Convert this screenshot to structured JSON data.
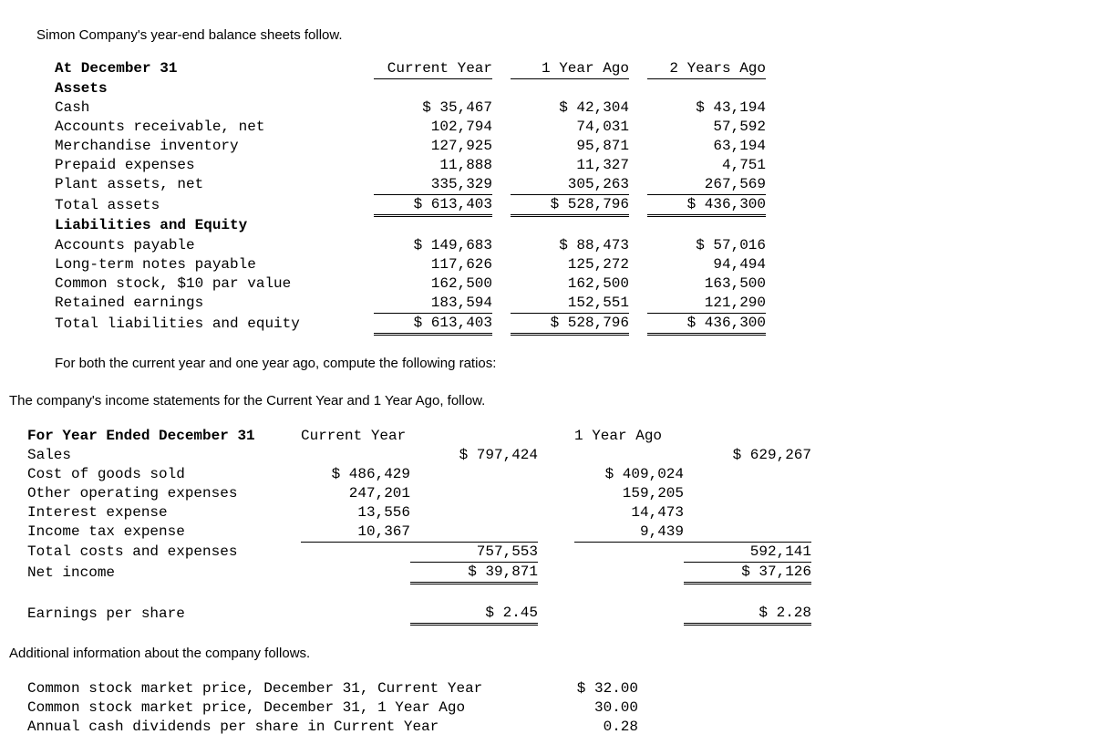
{
  "intro1": "Simon Company's year-end balance sheets follow.",
  "bs": {
    "header": {
      "label": "At December 31",
      "c1": "Current Year",
      "c2": "1 Year Ago",
      "c3": "2 Years Ago"
    },
    "assets_hdr": "Assets",
    "rows_assets": [
      {
        "label": "Cash",
        "c1": "$ 35,467",
        "c2": "$ 42,304",
        "c3": "$ 43,194"
      },
      {
        "label": "Accounts receivable, net",
        "c1": "102,794",
        "c2": "74,031",
        "c3": "57,592"
      },
      {
        "label": "Merchandise inventory",
        "c1": "127,925",
        "c2": "95,871",
        "c3": "63,194"
      },
      {
        "label": "Prepaid expenses",
        "c1": "11,888",
        "c2": "11,327",
        "c3": "4,751"
      },
      {
        "label": "Plant assets, net",
        "c1": "335,329",
        "c2": "305,263",
        "c3": "267,569"
      }
    ],
    "total_assets": {
      "label": "Total assets",
      "c1": "$ 613,403",
      "c2": "$ 528,796",
      "c3": "$ 436,300"
    },
    "liab_hdr": "Liabilities and Equity",
    "rows_liab": [
      {
        "label": "Accounts payable",
        "c1": "$ 149,683",
        "c2": "$ 88,473",
        "c3": "$ 57,016"
      },
      {
        "label": "Long-term notes payable",
        "c1": "117,626",
        "c2": "125,272",
        "c3": "94,494"
      },
      {
        "label": "Common stock, $10 par value",
        "c1": "162,500",
        "c2": "162,500",
        "c3": "163,500"
      },
      {
        "label": "Retained earnings",
        "c1": "183,594",
        "c2": "152,551",
        "c3": "121,290"
      }
    ],
    "total_liab": {
      "label": "Total liabilities and equity",
      "c1": "$ 613,403",
      "c2": "$ 528,796",
      "c3": "$ 436,300"
    }
  },
  "intro2": "For both the current year and one year ago, compute the following ratios:",
  "intro3": "The company's income statements for the Current Year and 1 Year Ago, follow.",
  "is": {
    "header": {
      "label": "For Year Ended December 31",
      "c1": "Current Year",
      "c2": "1 Year Ago"
    },
    "sales": {
      "label": "Sales",
      "c1": "$ 797,424",
      "c2": "$ 629,267"
    },
    "expenses": [
      {
        "label": "Cost of goods sold",
        "c1": "$ 486,429",
        "c2": "$ 409,024"
      },
      {
        "label": "Other operating expenses",
        "c1": "247,201",
        "c2": "159,205"
      },
      {
        "label": "Interest expense",
        "c1": "13,556",
        "c2": "14,473"
      },
      {
        "label": "Income tax expense",
        "c1": "10,367",
        "c2": "9,439"
      }
    ],
    "total_costs": {
      "label": "Total costs and expenses",
      "c1": "757,553",
      "c2": "592,141"
    },
    "net_income": {
      "label": "Net income",
      "c1": "$ 39,871",
      "c2": "$ 37,126"
    },
    "eps": {
      "label": "Earnings per share",
      "c1": "$ 2.45",
      "c2": "$ 2.28"
    }
  },
  "intro4": "Additional information about the company follows.",
  "addl": [
    {
      "label": "Common stock market price, December 31, Current Year",
      "val": "$ 32.00"
    },
    {
      "label": "Common stock market price, December 31, 1 Year Ago",
      "val": "30.00"
    },
    {
      "label": "Annual cash dividends per share in Current Year",
      "val": "0.28"
    }
  ]
}
